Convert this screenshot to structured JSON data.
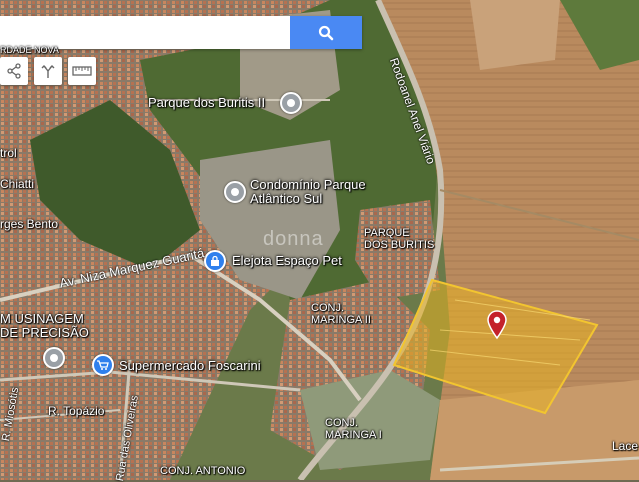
{
  "search": {
    "value": "",
    "placeholder": ""
  },
  "toolbar": {
    "icons": [
      "share-icon",
      "directions-icon",
      "ruler-icon"
    ]
  },
  "road_labels": {
    "anel_viario": "Rodoanel Anel Viário",
    "niza": "Av. Niza Marquez Guaritá",
    "topazio": "R. Topázio",
    "oliveiras": "Rua das Oliveiras",
    "miosotis": "R. Miosótis",
    "chiatti": "Chiatti",
    "borges_bento": "rges Bento",
    "trol": "trol",
    "lace": "Lace",
    "nova": "RDADE NOVA"
  },
  "area_labels": {
    "parque_buritis_top": "PARQUE\nDOS BURITIS",
    "maringa_ii": "CONJ.\nMARINGA II",
    "maringa_i": "CONJ.\nMARINGA I",
    "conj_antonio": "CONJ. ANTONIO",
    "usinagem": "M USINAGEM\nDE PRECISÃO"
  },
  "pois": {
    "parque_buritis_ii": "Parque dos Buritis II",
    "condominio": "Condomínio Parque\nAtlântico Sul",
    "elejota": "Elejota Espaço Pet",
    "supermercado": "Supermercado Foscarini"
  },
  "watermark": "donna",
  "colors": {
    "highlight_fill": "#e8b223",
    "highlight_stroke": "#f2c530",
    "pin_red": "#c4222b",
    "search_blue": "#4a89f3"
  }
}
